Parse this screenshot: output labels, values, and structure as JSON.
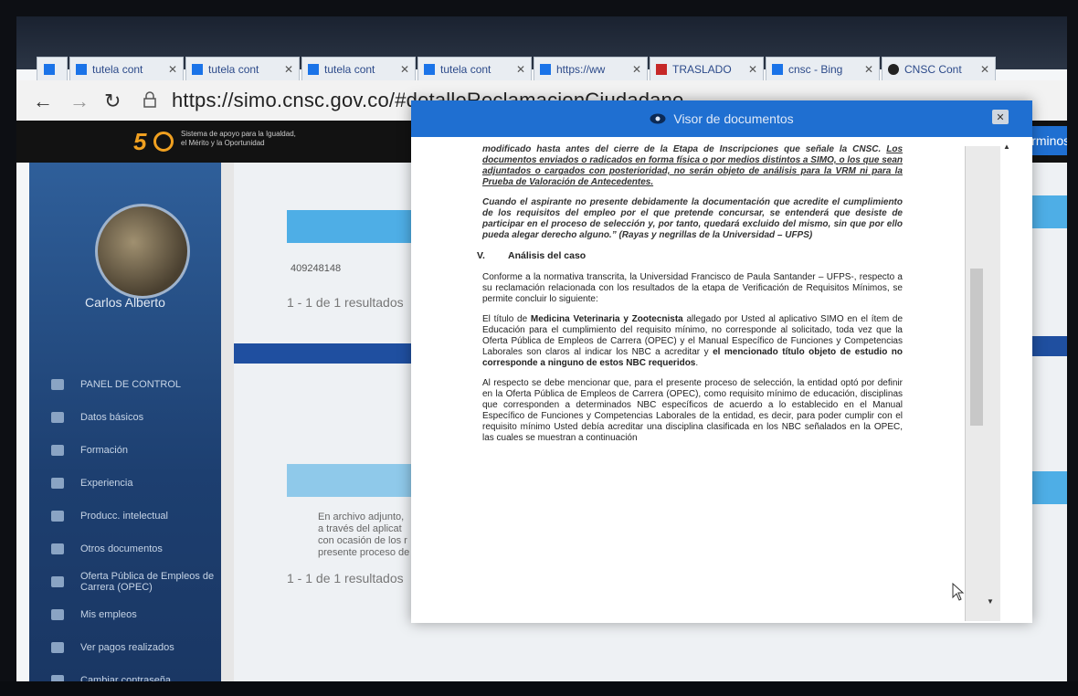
{
  "browser": {
    "tabs": [
      {
        "label": "",
        "icon": "tab-list-icon",
        "variant": "first"
      },
      {
        "label": "tutela cont",
        "icon": "word-doc-icon"
      },
      {
        "label": "tutela cont",
        "icon": "word-doc-icon"
      },
      {
        "label": "tutela cont",
        "icon": "word-doc-icon"
      },
      {
        "label": "tutela cont",
        "icon": "word-doc-icon"
      },
      {
        "label": "https://ww",
        "icon": "word-doc-icon"
      },
      {
        "label": "TRASLADO",
        "icon": "pdf-icon"
      },
      {
        "label": "cnsc - Bing",
        "icon": "bing-icon"
      },
      {
        "label": "CNSC Cont",
        "icon": "cnsc-icon"
      }
    ],
    "close_glyph": "✕",
    "url": "https://simo.cnsc.gov.co/#detalleReclamacionCiudadano"
  },
  "app": {
    "logo_number": "5",
    "tagline_line1": "Sistema de apoyo para la Igualdad,",
    "tagline_line2": "el Mérito y la Oportunidad",
    "terminos_label": "Términos"
  },
  "sidebar": {
    "username": "Carlos Alberto",
    "items": [
      {
        "label": "PANEL DE CONTROL"
      },
      {
        "label": "Datos básicos"
      },
      {
        "label": "Formación"
      },
      {
        "label": "Experiencia"
      },
      {
        "label": "Producc. intelectual"
      },
      {
        "label": "Otros documentos"
      },
      {
        "label": "Oferta Pública de Empleos de Carrera (OPEC)"
      },
      {
        "label": "Mis empleos"
      },
      {
        "label": "Ver pagos realizados"
      },
      {
        "label": "Cambiar contraseña"
      }
    ]
  },
  "main": {
    "id_number": "409248148",
    "results_top": "1 - 1 de 1 resultados",
    "results_bottom": "1 - 1 de 1 resultados",
    "ghost_text_1": "En archivo adjunto,",
    "ghost_text_2": "a través del aplicat",
    "ghost_text_3": "con ocasión de los r",
    "ghost_text_4": "presente proceso de"
  },
  "modal": {
    "title": "Visor de documentos",
    "close_label": "✕",
    "doc": {
      "quote_1a": "modificado hasta antes del cierre de la Etapa de Inscripciones que señale la CNSC.",
      "quote_1b": "Los documentos enviados o radicados en forma física o por medios distintos a SIMO, o los que sean adjuntados o cargados con posterioridad, no serán objeto de análisis para la VRM ni para la Prueba de Valoración de Antecedentes.",
      "quote_2": "Cuando el aspirante no presente debidamente la documentación que acredite el cumplimiento de los requisitos del empleo por el que pretende concursar, se entenderá que desiste de participar en el proceso de selección y, por tanto, quedará excluido del mismo, sin que por ello pueda alegar derecho alguno.” (Rayas y negrillas de la Universidad – UFPS)",
      "section_number": "V.",
      "section_title": "Análisis del caso",
      "para_1": "Conforme a la normativa transcrita, la Universidad Francisco de Paula Santander – UFPS-, respecto a su reclamación relacionada con los resultados de la etapa de Verificación de Requisitos Mínimos, se permite concluir lo siguiente:",
      "para_2a": "El título de",
      "para_2b": "Medicina Veterinaria y Zootecnista",
      "para_2c": "allegado por Usted al aplicativo SIMO en el ítem de Educación para el cumplimiento del requisito mínimo, no corresponde al solicitado, toda vez que la Oferta Pública de Empleos de Carrera (OPEC) y el Manual Específico de Funciones y Competencias Laborales son claros al indicar los NBC a acreditar y",
      "para_2d": "el mencionado título objeto de estudio no corresponde a ninguno de estos NBC requeridos",
      "para_3": "Al respecto se debe mencionar que, para el presente proceso de selección, la entidad optó por definir en la Oferta Pública de Empleos de Carrera (OPEC), como requisito mínimo de educación, disciplinas que corresponden a determinados NBC específicos de acuerdo a lo establecido en el Manual Específico de Funciones y Competencias Laborales de la entidad, es decir, para poder cumplir con el requisito mínimo Usted debía acreditar una disciplina clasificada en los NBC señalados en la OPEC, las cuales se muestran a continuación"
    }
  }
}
